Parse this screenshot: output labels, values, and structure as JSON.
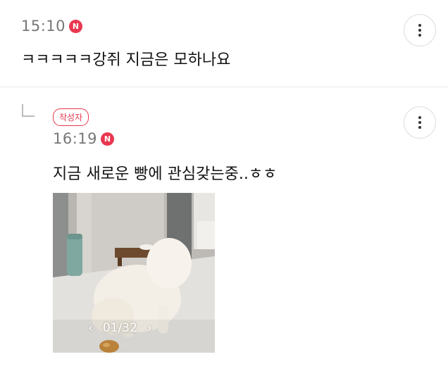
{
  "comment1": {
    "time": "15:10",
    "new_badge": "N",
    "text": "ㅋㅋㅋㅋㅋ강쥐 지금은 모하나요"
  },
  "reply1": {
    "author_badge": "작성자",
    "time": "16:19",
    "new_badge": "N",
    "text": "지금 새로운 빵에 관심갖는중..ㅎㅎ",
    "photo": {
      "counter": "01/32",
      "prev_icon": "chevron-left-icon",
      "next_icon": "chevron-right-icon"
    }
  },
  "colors": {
    "accent": "#e8384f",
    "time_text": "#777777",
    "divider": "#e6e6e6"
  }
}
